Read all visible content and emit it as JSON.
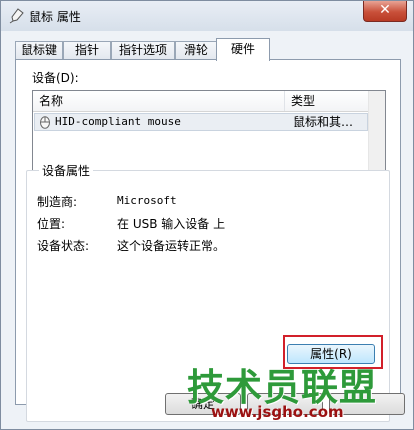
{
  "window": {
    "title": "鼠标 属性",
    "close_label": "✕"
  },
  "tabs": [
    {
      "label": "鼠标键"
    },
    {
      "label": "指针"
    },
    {
      "label": "指针选项"
    },
    {
      "label": "滑轮"
    },
    {
      "label": "硬件",
      "active": true
    }
  ],
  "devices": {
    "label": "设备(D):",
    "columns": {
      "name": "名称",
      "type": "类型"
    },
    "rows": [
      {
        "name": "HID-compliant mouse",
        "type": "鼠标和其…",
        "icon": "mouse-icon"
      }
    ]
  },
  "properties": {
    "title": "设备属性",
    "manufacturer_label": "制造商:",
    "manufacturer_value": "Microsoft",
    "location_label": "位置:",
    "location_value": "在 USB 输入设备 上",
    "status_label": "设备状态:",
    "status_value": "这个设备运转正常。"
  },
  "buttons": {
    "properties": "属性(R)",
    "ok": "确定"
  },
  "watermark": {
    "brand": "技术员联盟",
    "url": "www.jsgho.com"
  },
  "colors": {
    "highlight": "#d2202a",
    "watermark_green": "#2e9a3a",
    "watermark_red": "#9b1111"
  }
}
